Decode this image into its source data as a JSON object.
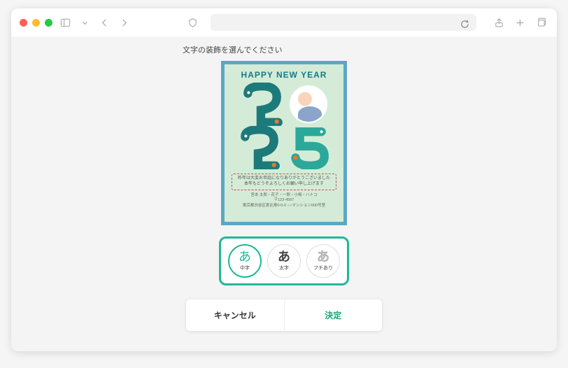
{
  "heading": "文字の装飾を選んでください",
  "card": {
    "title": "HAPPY NEW YEAR",
    "year": "2025",
    "msg_line1": "昨年は大変お世話になりありがとうございました",
    "msg_line2": "本年もどうぞよろしくお願い申し上げます",
    "addr_line1": "宮本 太郎・花子・一郎・小梅・ハナコ",
    "addr_line2": "〒123-4567",
    "addr_line3": "東京都渋谷区恵比寿0-0-0 ○○マンション000号室"
  },
  "options": [
    {
      "glyph": "あ",
      "label": "中字",
      "selected": true
    },
    {
      "glyph": "あ",
      "label": "太字",
      "selected": false
    },
    {
      "glyph": "あ",
      "label": "フチあり",
      "selected": false
    }
  ],
  "actions": {
    "cancel": "キャンセル",
    "confirm": "決定"
  }
}
